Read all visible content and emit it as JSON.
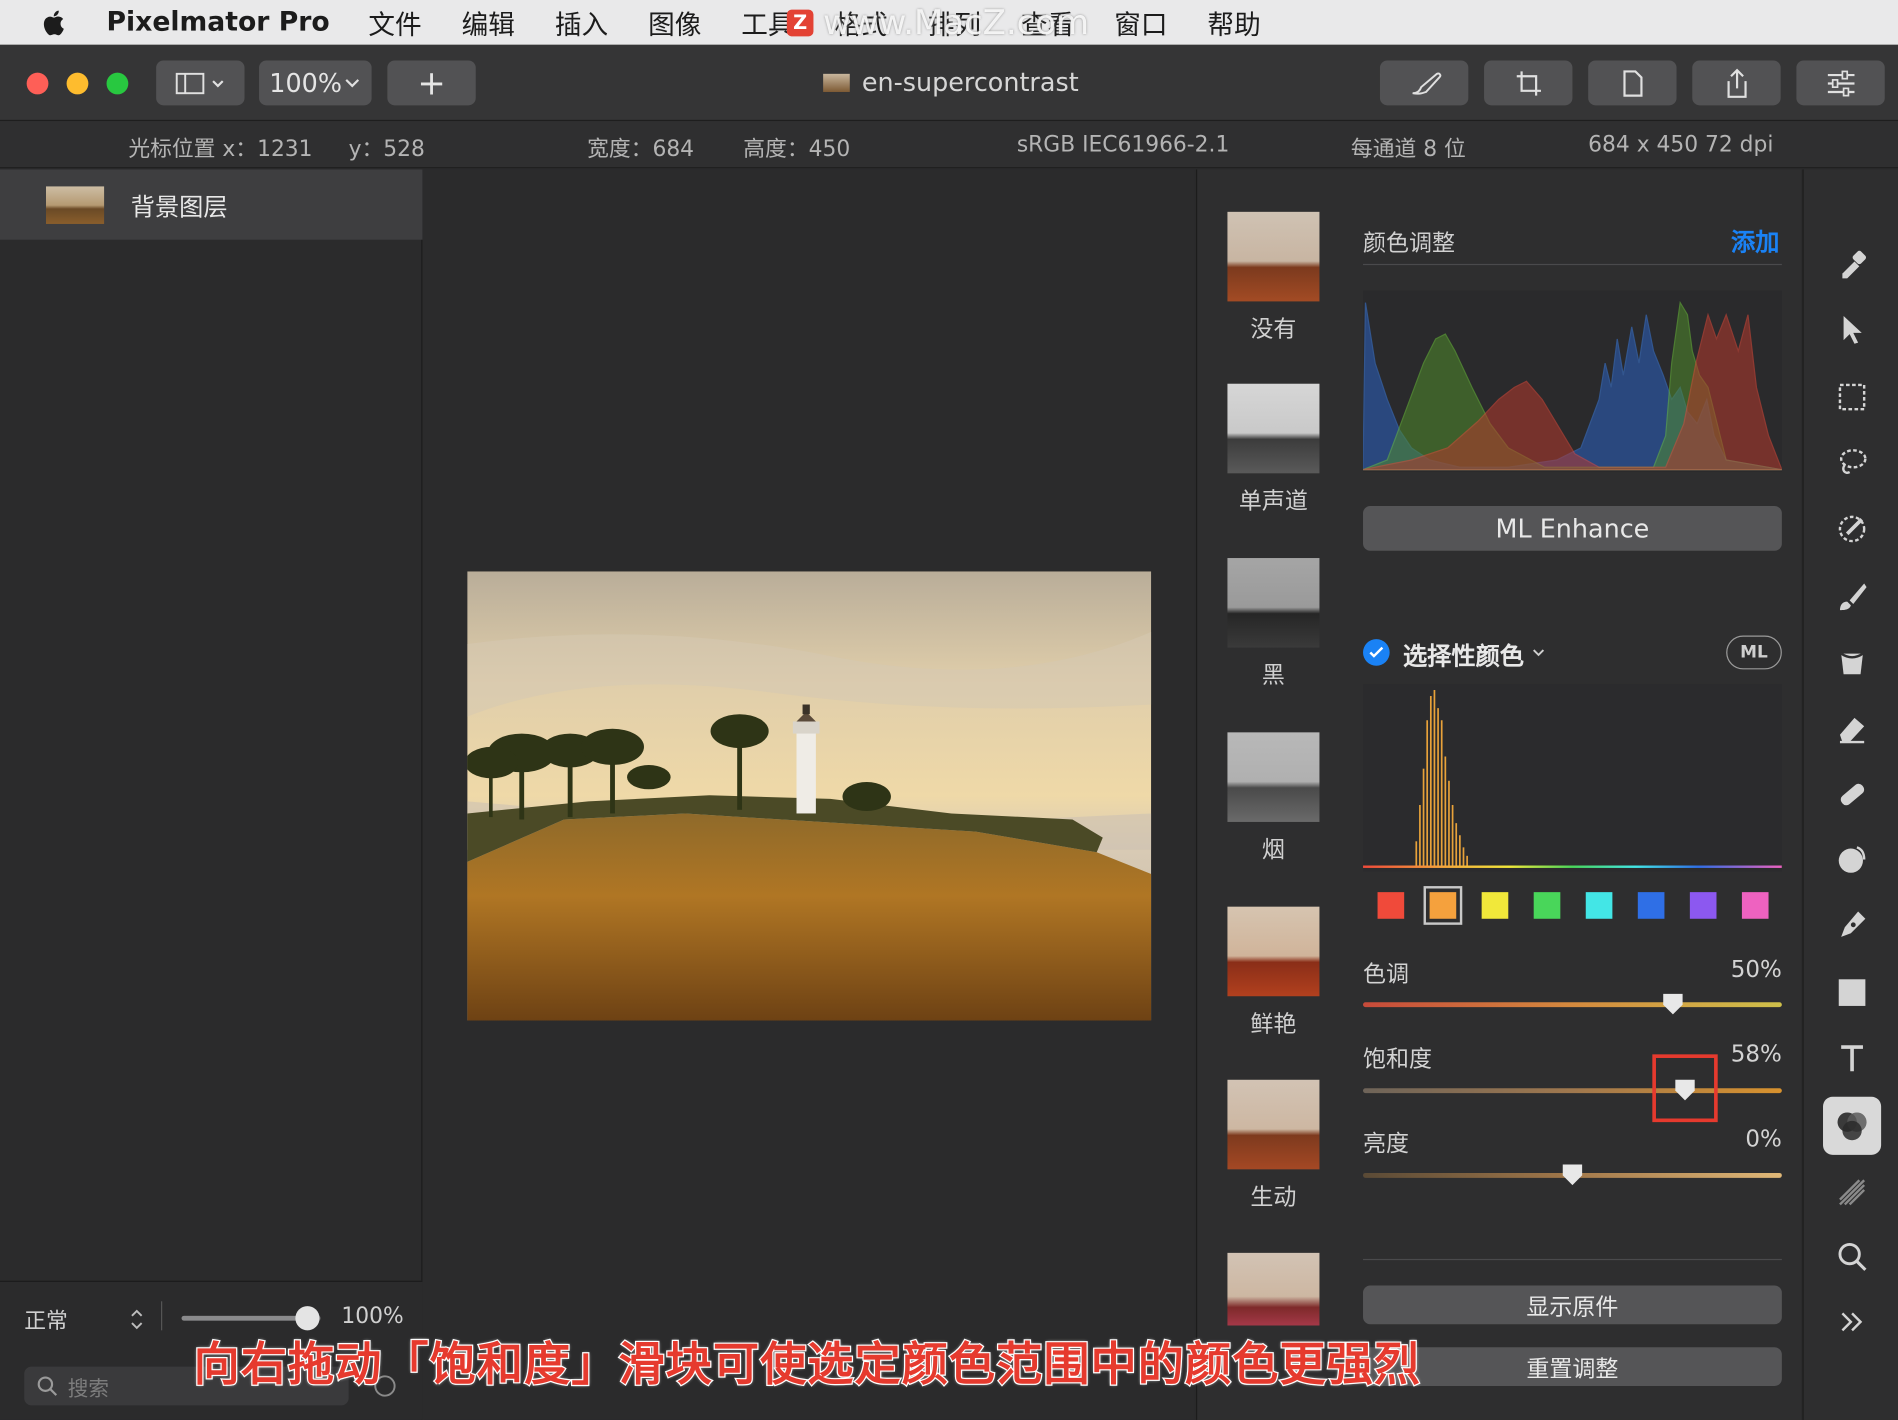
{
  "menubar": {
    "app_name": "Pixelmator Pro",
    "items": [
      "文件",
      "编辑",
      "插入",
      "图像",
      "工具",
      "格式",
      "排列",
      "查看",
      "窗口",
      "帮助"
    ],
    "watermark": "www.MacZ.com"
  },
  "toolbar": {
    "zoom": "100%",
    "add_label": "+",
    "document_title": "en-supercontrast"
  },
  "infobar": {
    "cursor_x": "光标位置 x：1231",
    "cursor_y": "y：528",
    "width": "宽度：684",
    "height": "高度：450",
    "color_profile": "sRGB IEC61966-2.1",
    "bits": "每通道 8 位",
    "size": "684 x 450 72 dpi"
  },
  "layers": {
    "items": [
      {
        "name": "背景图层"
      }
    ],
    "blend_mode": "正常",
    "opacity": "100%",
    "opacity_fraction": 0.9,
    "search_placeholder": "搜索"
  },
  "presets": [
    {
      "label": "没有"
    },
    {
      "label": "单声道"
    },
    {
      "label": "黑"
    },
    {
      "label": "烟"
    },
    {
      "label": "鲜艳"
    },
    {
      "label": "生动"
    }
  ],
  "adjustments": {
    "title": "颜色调整",
    "add_label": "添加",
    "ml_enhance": "ML Enhance",
    "selective_color": {
      "title": "选择性颜色",
      "ml_badge": "ML",
      "enabled": true,
      "swatches": [
        "#f04a3a",
        "#f5a13d",
        "#f1e83a",
        "#49d65a",
        "#43e6e6",
        "#2f6fe6",
        "#8c58f0",
        "#ee62c0"
      ],
      "selected_swatch": 1,
      "sliders": [
        {
          "label": "色调",
          "value": "50%",
          "fraction": 0.74
        },
        {
          "label": "饱和度",
          "value": "58%",
          "fraction": 0.77
        },
        {
          "label": "亮度",
          "value": "0%",
          "fraction": 0.5
        }
      ]
    },
    "show_original": "显示原件",
    "reset": "重置调整"
  },
  "caption": "向右拖动「饱和度」滑块可使选定颜色范围中的颜色更强烈",
  "colors": {
    "accent": "#1a82f5",
    "highlight": "#e63a2e"
  }
}
